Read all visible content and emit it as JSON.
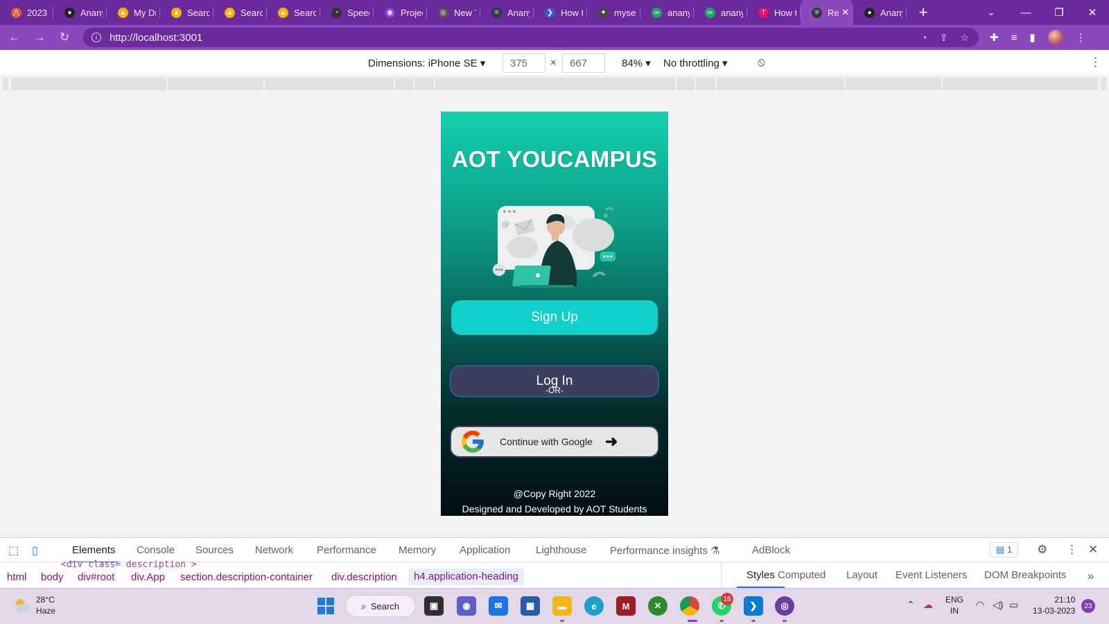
{
  "browser": {
    "tabs": [
      {
        "label": "2023 S",
        "icon": "strava-icon",
        "color": "#e8553a"
      },
      {
        "label": "Anany",
        "icon": "github-icon",
        "color": "#222222"
      },
      {
        "label": "My Dr",
        "icon": "google-drive-icon",
        "color": "#f4b400"
      },
      {
        "label": "Search",
        "icon": "google-drive-icon",
        "color": "#f4b400"
      },
      {
        "label": "Search",
        "icon": "google-drive-icon",
        "color": "#f4b400"
      },
      {
        "label": "Search",
        "icon": "google-drive-icon",
        "color": "#f4b400"
      },
      {
        "label": "Speed",
        "icon": "speedometer-icon",
        "color": "#333333"
      },
      {
        "label": "Projec",
        "icon": "project-icon",
        "color": "#8d3de2"
      },
      {
        "label": "New T",
        "icon": "chrome-icon",
        "color": "#555555"
      },
      {
        "label": "Anany",
        "icon": "react-icon",
        "color": "#2b3a42"
      },
      {
        "label": "How t",
        "icon": "powershell-icon",
        "color": "#3b57d6"
      },
      {
        "label": "mysel",
        "icon": "compass-icon",
        "color": "#444444"
      },
      {
        "label": "anany",
        "icon": "infinity-icon",
        "color": "#21a366"
      },
      {
        "label": "anany",
        "icon": "infinity-icon",
        "color": "#21a366"
      },
      {
        "label": "How t",
        "icon": "tabnine-icon",
        "color": "#e2116b"
      }
    ],
    "active_tab": {
      "label": "Re",
      "icon": "react-icon"
    },
    "last_tab": {
      "label": "Anany",
      "icon": "github-icon"
    },
    "new_tab": "+",
    "url": "http://localhost:3001"
  },
  "device_toolbar": {
    "dimensions_label": "Dimensions: iPhone SE",
    "width": "375",
    "height": "667",
    "times": "×",
    "zoom": "84%",
    "throttling": "No throttling"
  },
  "app": {
    "title": "AOT YOUCAMPUS",
    "signup_label": "Sign Up",
    "login_label": "Log In",
    "or_text": "-OR-",
    "google_label": "Continue with Google",
    "copyright": "@Copy Right 2022",
    "credits": "Designed and Developed by AOT Students",
    "colors": {
      "gradient_top": "#14d0ad",
      "gradient_bottom": "#020d16",
      "signup_bg": "#11cfcb",
      "login_bg": "#3b3e5c"
    }
  },
  "devtools": {
    "tabs": [
      "Elements",
      "Console",
      "Sources",
      "Network",
      "Performance",
      "Memory",
      "Application",
      "Lighthouse",
      "Performance insights",
      "AdBlock"
    ],
    "active_tab": "Elements",
    "issues_count": "1",
    "ghost_code": "<div class= description >",
    "breadcrumbs": [
      "html",
      "body",
      "div#root",
      "div.App",
      "section.description-container",
      "div.description",
      "h4.application-heading"
    ],
    "styles_tabs": [
      "Styles",
      "Computed",
      "Layout",
      "Event Listeners",
      "DOM Breakpoints"
    ],
    "active_styles_tab": "Styles"
  },
  "taskbar": {
    "weather_temp": "28°C",
    "weather_desc": "Haze",
    "search_label": "Search",
    "whatsapp_badge": "16",
    "lang_line1": "ENG",
    "lang_line2": "IN",
    "time": "21:10",
    "date": "13-03-2023",
    "notifications": "23"
  }
}
